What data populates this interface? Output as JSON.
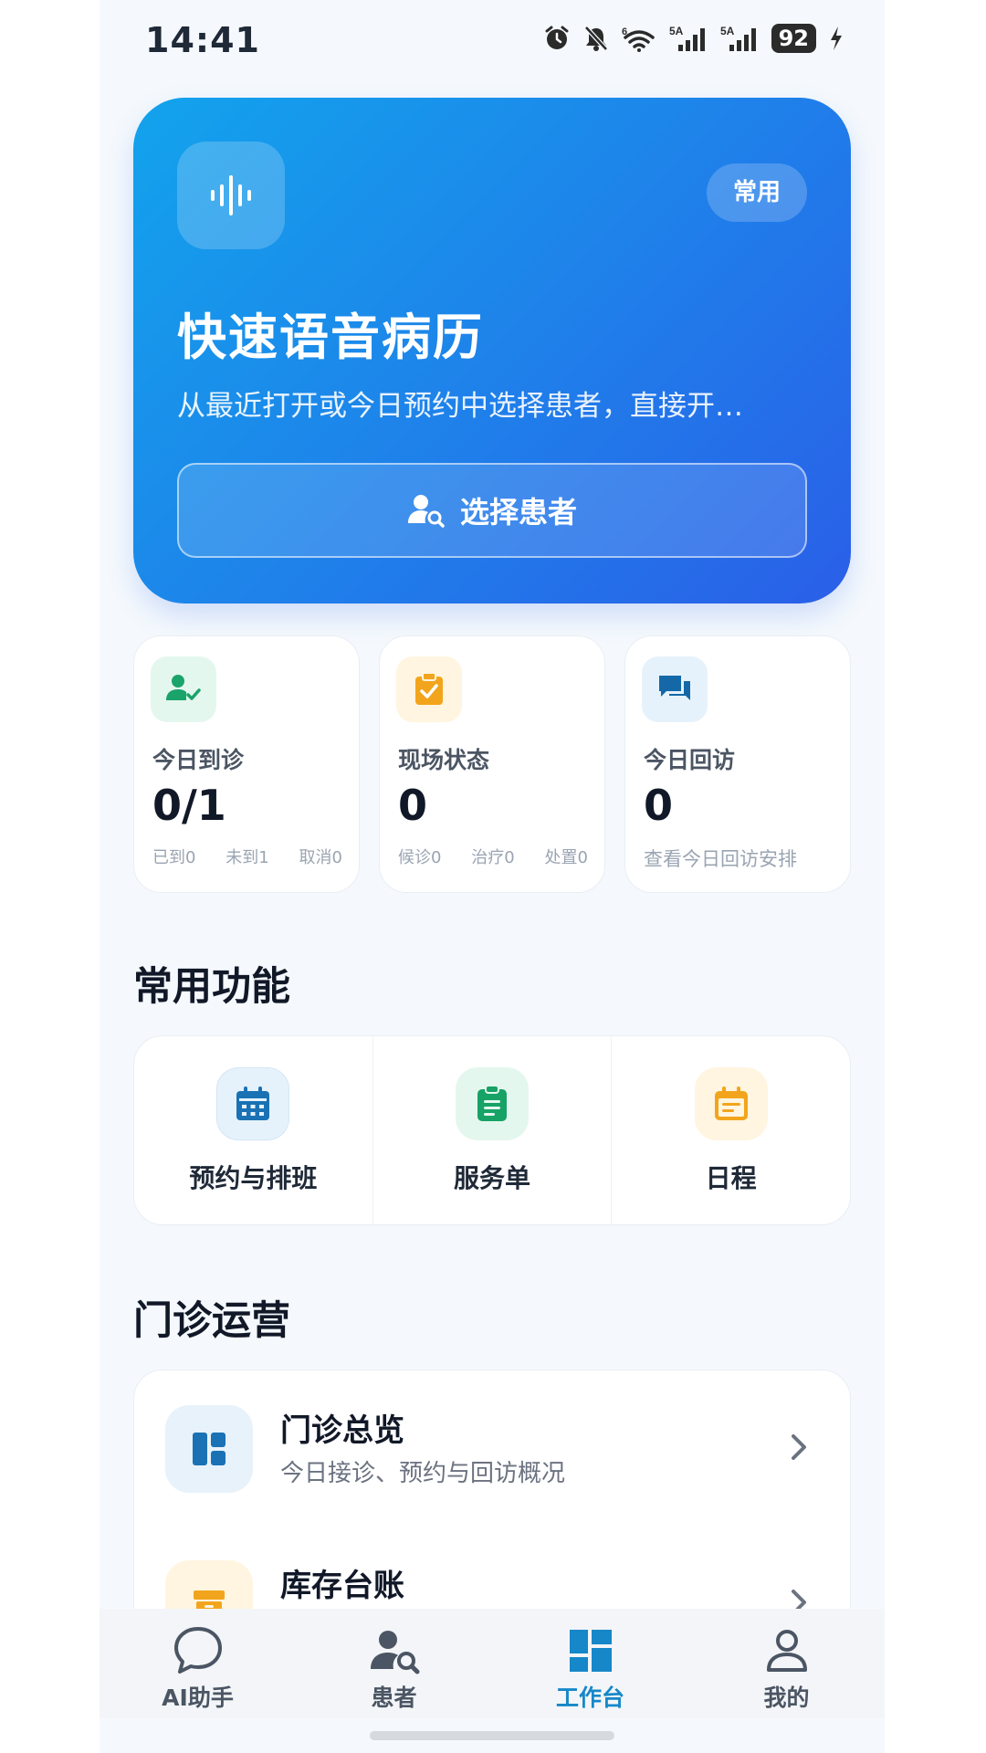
{
  "status_bar": {
    "time": "14:41",
    "battery": "92"
  },
  "hero": {
    "icon": "voice-waveform-icon",
    "badge": "常用",
    "title": "快速语音病历",
    "subtitle": "从最近打开或今日预约中选择患者，直接开…",
    "button_label": "选择患者",
    "colors": {
      "gradient_start": "#12a3ec",
      "gradient_end": "#2a5fe8"
    }
  },
  "stats": [
    {
      "icon": "user-check-icon",
      "label": "今日到诊",
      "value": "0/1",
      "sub": [
        "已到0",
        "未到1",
        "取消0"
      ]
    },
    {
      "icon": "clipboard-check-icon",
      "label": "现场状态",
      "value": "0",
      "sub": [
        "候诊0",
        "治疗0",
        "处置0"
      ]
    },
    {
      "icon": "chat-bubbles-icon",
      "label": "今日回访",
      "value": "0",
      "sub": [
        "查看今日回访安排"
      ]
    }
  ],
  "common_functions": {
    "title": "常用功能",
    "items": [
      {
        "icon": "calendar-grid-icon",
        "label": "预约与排班"
      },
      {
        "icon": "document-list-icon",
        "label": "服务单"
      },
      {
        "icon": "calendar-schedule-icon",
        "label": "日程"
      }
    ]
  },
  "clinic_ops": {
    "title": "门诊运营",
    "items": [
      {
        "icon": "dashboard-icon",
        "title": "门诊总览",
        "desc": "今日接诊、预约与回访概况"
      },
      {
        "icon": "inventory-box-icon",
        "title": "库存台账",
        "desc": ""
      }
    ]
  },
  "bottom_nav": {
    "active": "工作台",
    "items": [
      {
        "icon": "chat-icon",
        "label": "AI助手"
      },
      {
        "icon": "patient-search-icon",
        "label": "患者"
      },
      {
        "icon": "workbench-grid-icon",
        "label": "工作台"
      },
      {
        "icon": "profile-icon",
        "label": "我的"
      }
    ],
    "active_color": "#1687c8"
  }
}
